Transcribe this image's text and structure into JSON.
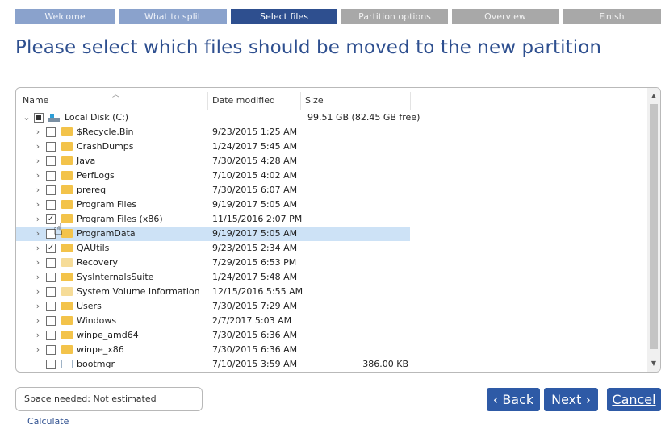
{
  "steps": [
    "Welcome",
    "What to split",
    "Select files",
    "Partition options",
    "Overview",
    "Finish"
  ],
  "title": "Please select which files should be moved to the new partition",
  "columns": {
    "name": "Name",
    "date": "Date modified",
    "size": "Size"
  },
  "root": {
    "name": "Local Disk (C:)",
    "size": "99.51 GB (82.45 GB free)",
    "state": "partial",
    "icon": "drive-icon"
  },
  "items": [
    {
      "name": "$Recycle.Bin",
      "date": "9/23/2015 1:25 AM",
      "checked": false,
      "icon": "folder-icon"
    },
    {
      "name": "CrashDumps",
      "date": "1/24/2017 5:45 AM",
      "checked": false,
      "icon": "folder-icon"
    },
    {
      "name": "Java",
      "date": "7/30/2015 4:28 AM",
      "checked": false,
      "icon": "folder-icon"
    },
    {
      "name": "PerfLogs",
      "date": "7/10/2015 4:02 AM",
      "checked": false,
      "icon": "folder-icon"
    },
    {
      "name": "prereq",
      "date": "7/30/2015 6:07 AM",
      "checked": false,
      "icon": "folder-icon"
    },
    {
      "name": "Program Files",
      "date": "9/19/2017 5:05 AM",
      "checked": false,
      "icon": "folder-icon"
    },
    {
      "name": "Program Files (x86)",
      "date": "11/15/2016 2:07 PM",
      "checked": true,
      "icon": "folder-icon"
    },
    {
      "name": "ProgramData",
      "date": "9/19/2017 5:05 AM",
      "checked": false,
      "icon": "folder-icon",
      "selected": true
    },
    {
      "name": "QAUtils",
      "date": "9/23/2015 2:34 AM",
      "checked": true,
      "icon": "folder-icon"
    },
    {
      "name": "Recovery",
      "date": "7/29/2015 6:53 PM",
      "checked": false,
      "icon": "folder-icon"
    },
    {
      "name": "SysInternalsSuite",
      "date": "1/24/2017 5:48 AM",
      "checked": false,
      "icon": "folder-icon"
    },
    {
      "name": "System Volume Information",
      "date": "12/15/2016 5:55 AM",
      "checked": false,
      "icon": "folder-icon"
    },
    {
      "name": "Users",
      "date": "7/30/2015 7:29 AM",
      "checked": false,
      "icon": "folder-icon"
    },
    {
      "name": "Windows",
      "date": "2/7/2017 5:03 AM",
      "checked": false,
      "icon": "folder-icon"
    },
    {
      "name": "winpe_amd64",
      "date": "7/30/2015 6:36 AM",
      "checked": false,
      "icon": "folder-icon"
    },
    {
      "name": "winpe_x86",
      "date": "7/30/2015 6:36 AM",
      "checked": false,
      "icon": "folder-icon"
    },
    {
      "name": "bootmgr",
      "date": "7/10/2015 3:59 AM",
      "size": "386.00 KB",
      "checked": false,
      "icon": "file-icon"
    }
  ],
  "footer": {
    "space_label": "Space needed: Not estimated",
    "calculate": "Calculate",
    "back": "‹ Back",
    "next": "Next ›",
    "cancel": "Cancel"
  },
  "colors": {
    "accent": "#2e4f8f",
    "button": "#2e5aa6",
    "selection": "#cde2f6"
  }
}
